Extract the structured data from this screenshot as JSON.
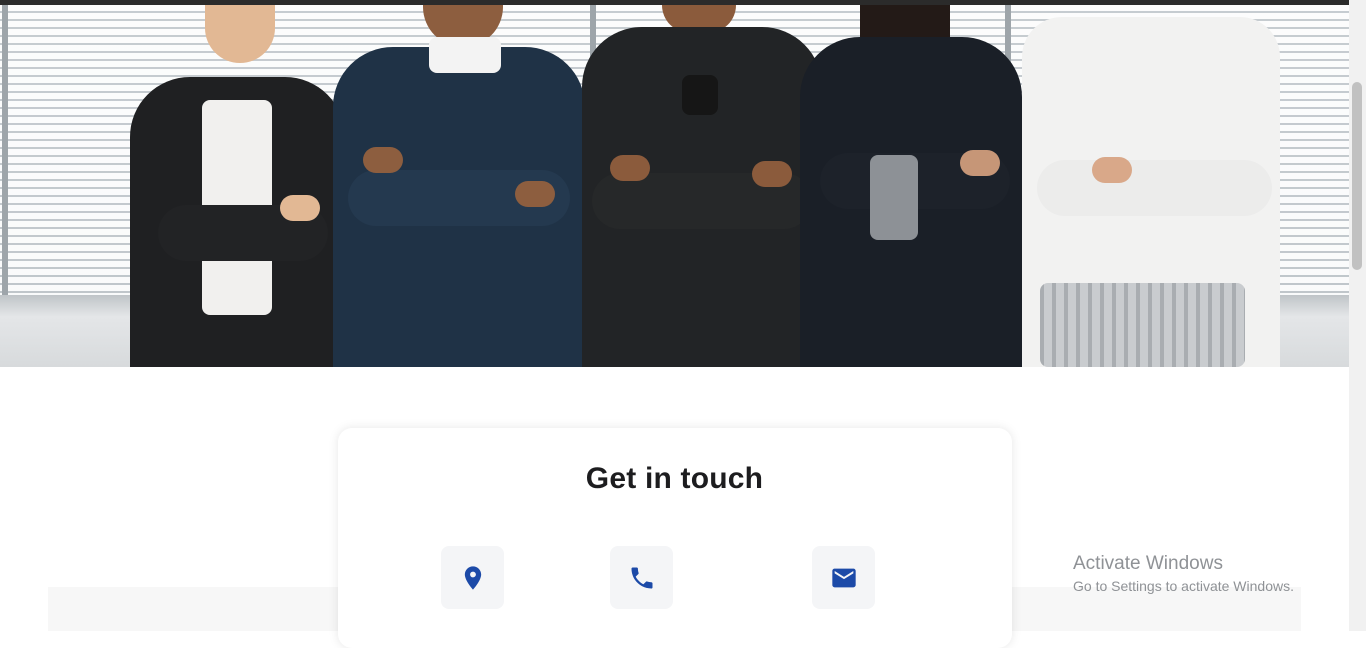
{
  "hero": {
    "image_alt": "Customer support team with headsets standing with arms crossed"
  },
  "contact": {
    "title": "Get in touch",
    "icons": [
      {
        "name": "location-pin-icon"
      },
      {
        "name": "phone-icon"
      },
      {
        "name": "email-icon"
      }
    ],
    "accent_color": "#1c4aa8"
  },
  "watermark": {
    "title": "Activate Windows",
    "subtitle": "Go to Settings to activate Windows."
  }
}
